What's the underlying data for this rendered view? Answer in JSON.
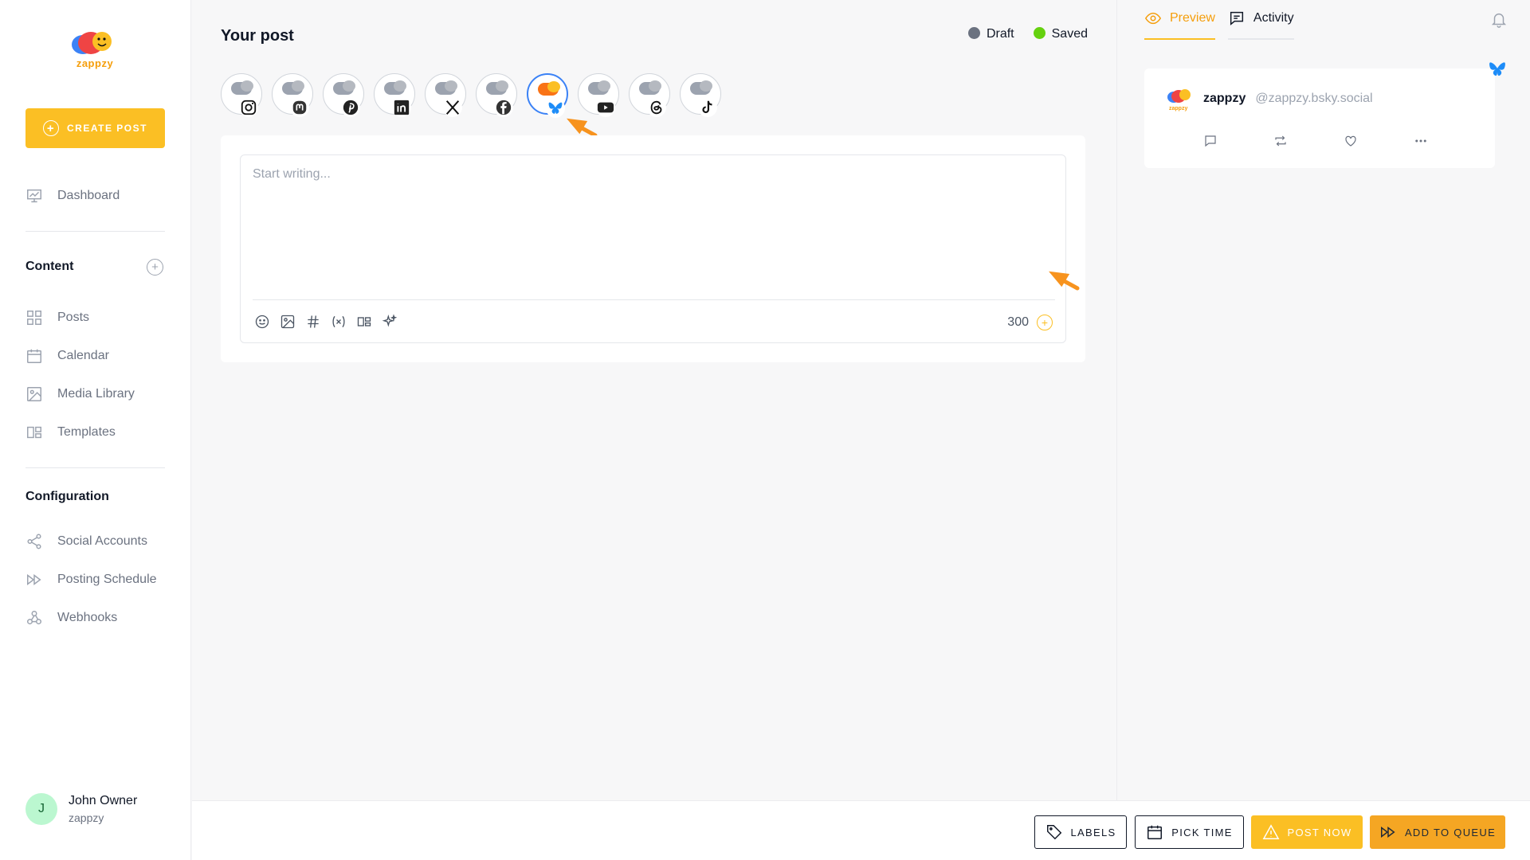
{
  "brand": {
    "name": "zappzy",
    "accent": "#fbbf24"
  },
  "sidebar": {
    "create_post": "CREATE POST",
    "dashboard": "Dashboard",
    "content_title": "Content",
    "items": [
      {
        "label": "Posts",
        "icon": "grid-icon"
      },
      {
        "label": "Calendar",
        "icon": "calendar-icon"
      },
      {
        "label": "Media Library",
        "icon": "image-icon"
      },
      {
        "label": "Templates",
        "icon": "templates-icon"
      }
    ],
    "configuration_title": "Configuration",
    "config_items": [
      {
        "label": "Social Accounts",
        "icon": "share-icon"
      },
      {
        "label": "Posting Schedule",
        "icon": "fast-forward-icon"
      },
      {
        "label": "Webhooks",
        "icon": "webhook-icon"
      }
    ],
    "user": {
      "initial": "J",
      "name": "John Owner",
      "org": "zappzy"
    }
  },
  "main": {
    "title": "Your post",
    "status": [
      {
        "label": "Draft",
        "color": "#6b7280"
      },
      {
        "label": "Saved",
        "color": "#65d10f"
      }
    ],
    "accounts": [
      {
        "network": "instagram-icon",
        "selected": false
      },
      {
        "network": "mastodon-icon",
        "selected": false
      },
      {
        "network": "pinterest-icon",
        "selected": false
      },
      {
        "network": "linkedin-icon",
        "selected": false
      },
      {
        "network": "x-icon",
        "selected": false
      },
      {
        "network": "facebook-icon",
        "selected": false
      },
      {
        "network": "bluesky-icon",
        "selected": true
      },
      {
        "network": "youtube-icon",
        "selected": false
      },
      {
        "network": "threads-icon",
        "selected": false
      },
      {
        "network": "tiktok-icon",
        "selected": false
      }
    ],
    "editor": {
      "placeholder": "Start writing...",
      "value": "",
      "char_count": "300"
    }
  },
  "right_panel": {
    "tabs": [
      {
        "label": "Preview",
        "active": true
      },
      {
        "label": "Activity",
        "active": false
      }
    ],
    "preview": {
      "name": "zappzy",
      "handle": "@zappzy.bsky.social"
    }
  },
  "bottom_bar": {
    "labels": "LABELS",
    "pick_time": "PICK TIME",
    "post_now": "POST NOW",
    "add_to_queue": "ADD TO QUEUE"
  }
}
